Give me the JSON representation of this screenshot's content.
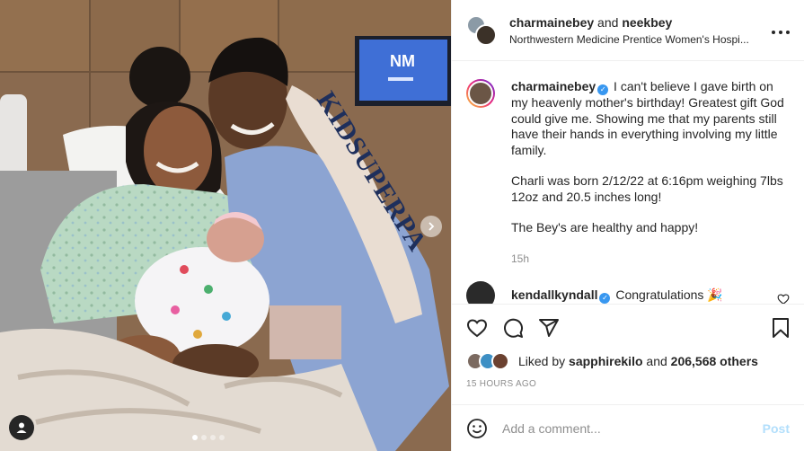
{
  "photo": {
    "monitor_logo": "NM",
    "jacket_text": "KIDSUPERPA",
    "carousel": {
      "count": 4,
      "active": 1
    }
  },
  "header": {
    "user1": "charmainebey",
    "and_text": " and ",
    "user2": "neekbey",
    "location": "Northwestern Medicine Prentice Women's Hospi...",
    "more_icon": "more-horizontal-icon"
  },
  "caption": {
    "username": "charmainebey",
    "line1": " I can't believe I gave birth on my heavenly mother's birthday! Greatest gift God could give me. Showing me that my parents still have their hands in everything involving my little family.",
    "line2": "Charli was born 2/12/22 at 6:16pm weighing 7lbs 12oz and 20.5 inches long!",
    "line3": "The Bey's are healthy and happy!",
    "time": "15h"
  },
  "comments": [
    {
      "username": "kendallkyndall",
      "text": " Congratulations 🎉"
    }
  ],
  "actions": {
    "like_icon": "heart-icon",
    "comment_icon": "comment-icon",
    "share_icon": "send-icon",
    "save_icon": "bookmark-icon"
  },
  "likes": {
    "prefix": "Liked by ",
    "first_user": "sapphirekilo",
    "middle": " and ",
    "others": "206,568 others"
  },
  "posted_ago": "15 HOURS AGO",
  "add_comment": {
    "placeholder": "Add a comment...",
    "post_label": "Post"
  },
  "colors": {
    "accent_blue": "#0095f6",
    "post_disabled": "#b2dffc",
    "verified": "#3897f0",
    "muted": "#8e8e8e"
  }
}
